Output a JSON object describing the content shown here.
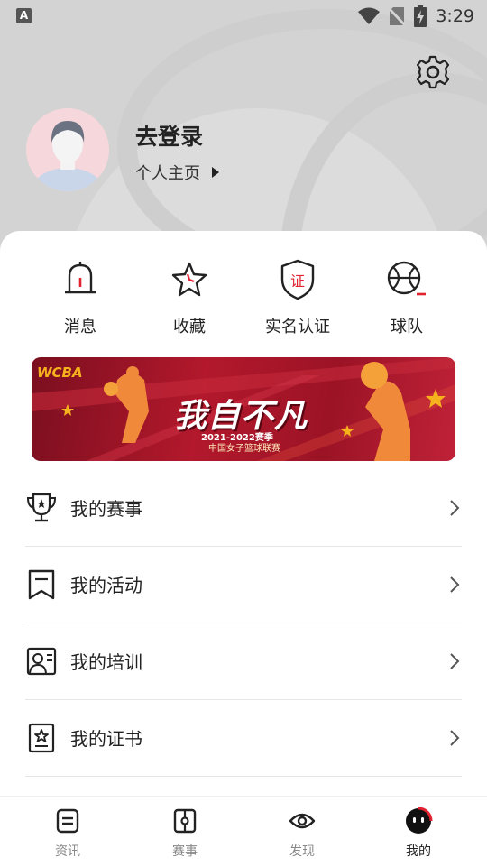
{
  "status_bar": {
    "time": "3:29",
    "app_badge": "A"
  },
  "profile": {
    "login_title": "去登录",
    "profile_link": "个人主页"
  },
  "quick_actions": [
    {
      "label": "消息",
      "icon": "bell-icon"
    },
    {
      "label": "收藏",
      "icon": "star-icon"
    },
    {
      "label": "实名认证",
      "icon": "verify-shield-icon",
      "badge": "证"
    },
    {
      "label": "球队",
      "icon": "basketball-icon"
    }
  ],
  "banner": {
    "logo": "WCBA",
    "title": "我自不凡",
    "subtitle_line1": "2021-2022赛季",
    "subtitle_line2": "中国女子篮球联赛"
  },
  "menu": [
    {
      "label": "我的赛事",
      "icon": "trophy-icon"
    },
    {
      "label": "我的活动",
      "icon": "bookmark-icon"
    },
    {
      "label": "我的培训",
      "icon": "training-icon"
    },
    {
      "label": "我的证书",
      "icon": "certificate-icon"
    }
  ],
  "tabs": [
    {
      "label": "资讯",
      "icon": "news-icon"
    },
    {
      "label": "赛事",
      "icon": "match-icon"
    },
    {
      "label": "发现",
      "icon": "eye-icon"
    },
    {
      "label": "我的",
      "icon": "me-icon",
      "active": true
    }
  ],
  "colors": {
    "accent": "#e2232f",
    "text": "#222222"
  }
}
